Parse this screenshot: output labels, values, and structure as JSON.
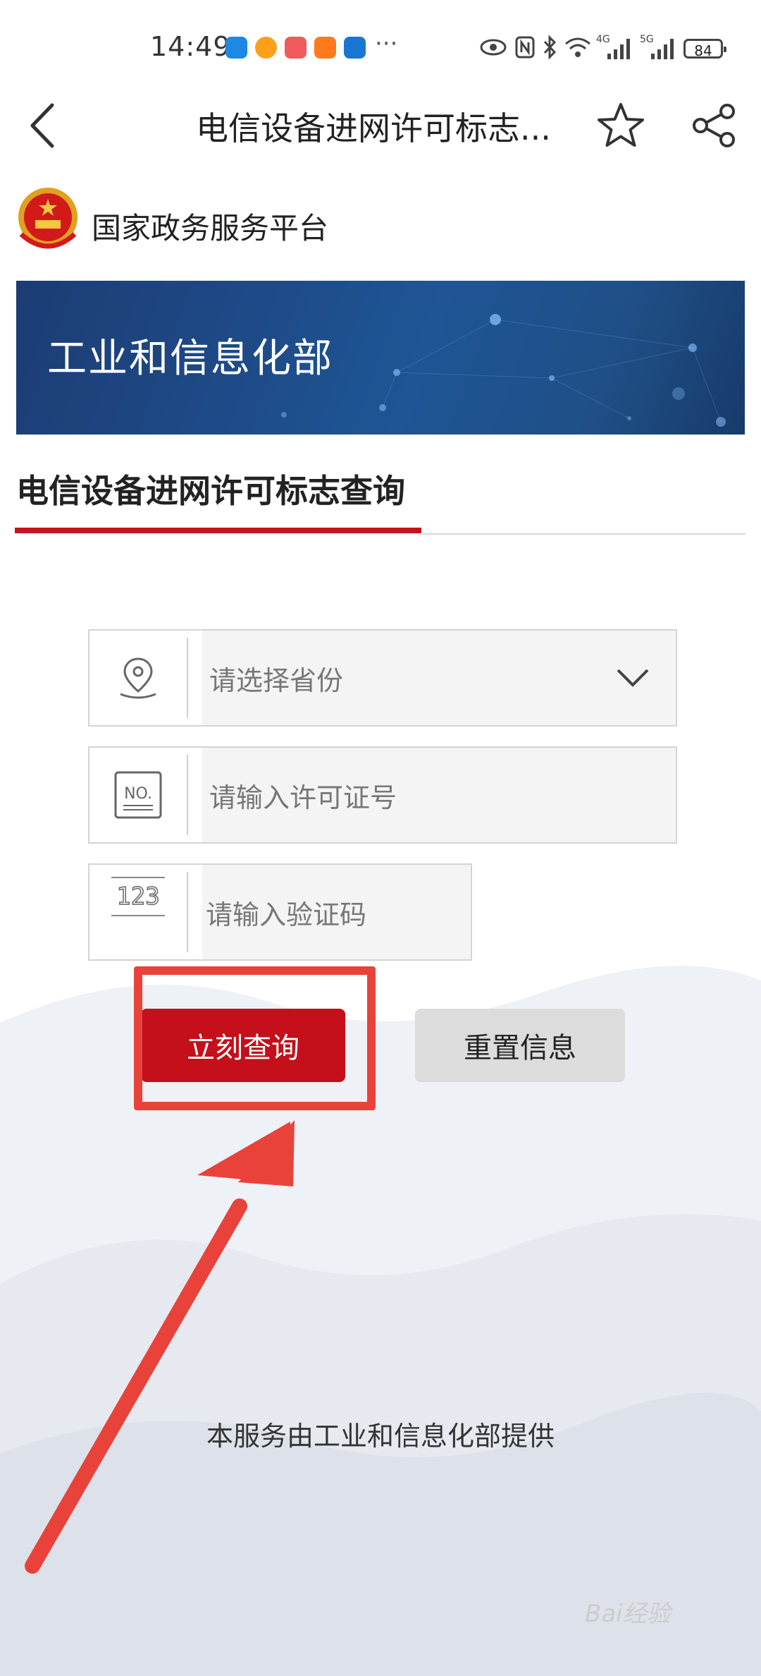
{
  "status_bar": {
    "time": "14:49",
    "more": "···",
    "signal_1": "4G",
    "signal_2": "5G",
    "battery": "84"
  },
  "nav": {
    "title": "电信设备进网许可标志..."
  },
  "header": {
    "gov_platform": "国家政务服务平台"
  },
  "banner": {
    "text": "工业和信息化部"
  },
  "section": {
    "title": "电信设备进网许可标志查询"
  },
  "form": {
    "province_placeholder": "请选择省份",
    "license_placeholder": "请输入许可证号",
    "captcha_placeholder": "请输入验证码",
    "captcha_icon_text": "123",
    "no_icon_text": "NO."
  },
  "buttons": {
    "query": "立刻查询",
    "reset": "重置信息"
  },
  "footer": {
    "text": "本服务由工业和信息化部提供"
  },
  "watermark": {
    "text": "Bai经验"
  },
  "colors": {
    "accent_red": "#c50f1a",
    "highlight": "#e8423a",
    "banner_blue": "#1f5595"
  }
}
